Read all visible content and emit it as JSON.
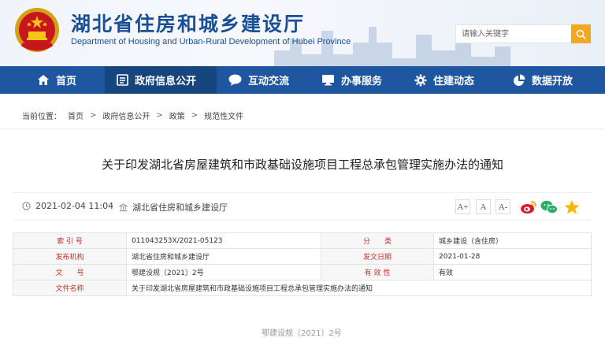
{
  "header": {
    "title": "湖北省住房和城乡建设厅",
    "subtitle": "Department of Housing and Urban-Rural Development of Hubei Province",
    "search_placeholder": "请输入关键字"
  },
  "nav": {
    "items": [
      {
        "label": "首页",
        "icon": "home-icon"
      },
      {
        "label": "政府信息公开",
        "icon": "document-list-icon"
      },
      {
        "label": "互动交流",
        "icon": "chat-bubble-icon"
      },
      {
        "label": "办事服务",
        "icon": "monitor-icon"
      },
      {
        "label": "住建动态",
        "icon": "gear-icon"
      },
      {
        "label": "数据开放",
        "icon": "pie-chart-icon"
      }
    ],
    "active_index": 1
  },
  "breadcrumb": {
    "prefix": "当前位置：",
    "items": [
      "首页",
      "政府信息公开",
      "政策",
      "规范性文件"
    ],
    "separator": ">"
  },
  "article": {
    "title": "关于印发湖北省房屋建筑和市政基础设施项目工程总承包管理实施办法的通知",
    "date": "2021-02-04 11:04",
    "source": "湖北省住房和城乡建设厅",
    "font_sizes": [
      "A+",
      "A",
      "A-"
    ]
  },
  "info_table": {
    "rows": [
      [
        "索 引 号",
        "011043253X/2021-05123",
        "分　　类",
        "城乡建设（含住房）"
      ],
      [
        "发布机构",
        "湖北省住房和城乡建设厅",
        "发文日期",
        "2021-01-28"
      ],
      [
        "文　　号",
        "鄂建设规〔2021〕2号",
        "有 效 性",
        "有效"
      ],
      [
        "文件名称",
        "关于印发湖北省房屋建筑和市政基础设施项目工程总承包管理实施办法的通知"
      ]
    ]
  },
  "body_preview": "鄂建设规〔2021〕2号",
  "colors": {
    "brand_blue": "#1e56a0",
    "nav_active": "#17467f",
    "search_button": "#f5a623",
    "label_red": "#c9302c"
  }
}
